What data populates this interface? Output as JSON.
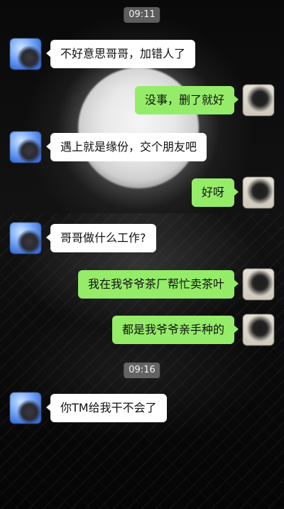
{
  "timestamps": [
    "09:11",
    "09:16"
  ],
  "messages": [
    {
      "side": "in",
      "text": "不好意思哥哥，加错人了"
    },
    {
      "side": "out",
      "text": "没事，删了就好"
    },
    {
      "side": "in",
      "text": "遇上就是缘份，交个朋友吧"
    },
    {
      "side": "out",
      "text": "好呀"
    },
    {
      "side": "in",
      "text": "哥哥做什么工作?"
    },
    {
      "side": "out",
      "text": "我在我爷爷茶厂帮忙卖茶叶"
    },
    {
      "side": "out",
      "text": "都是我爷爷亲手种的"
    },
    {
      "side": "in",
      "text": "你TM给我干不会了"
    }
  ],
  "colors": {
    "outgoing_bubble": "#95ec69",
    "incoming_bubble": "#ffffff",
    "timestamp_bg": "#9a9a9a"
  }
}
